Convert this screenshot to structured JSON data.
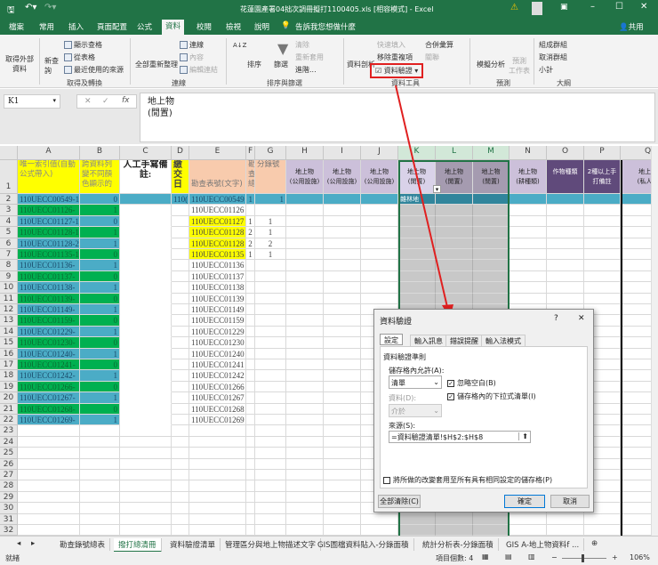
{
  "titlebar": {
    "title": "花蓮園產署04拙次調冊擬打1100405.xls [相容模式] - Excel",
    "share": "共用"
  },
  "ribbon_tabs": [
    "檔案",
    "常用",
    "插入",
    "頁面配置",
    "公式",
    "資料",
    "校閱",
    "檢視",
    "說明"
  ],
  "tell_me": "告訴我您想做什麼",
  "ribbon": {
    "get_external": "取得外部\n資料",
    "new_query": "新查\n詢",
    "show_queries": "顯示查格",
    "from_table": "從表格",
    "recent_sources": "最近使用的來源",
    "group_get": "取得及轉換",
    "refresh_all": "全部重新整理",
    "connections": "連線",
    "properties": "內容",
    "edit_links": "編輯連結",
    "group_conn": "連線",
    "sort": "排序",
    "filter": "篩選",
    "clear": "清除",
    "reapply": "重新套用",
    "advanced": "進階...",
    "group_sort": "排序與篩選",
    "text_to_columns": "資料剖析",
    "flash_fill": "快速填入",
    "remove_dup": "移除重複項",
    "data_validation": "資料驗證",
    "consolidate": "合併彙算",
    "relationships": "關聯",
    "group_tools": "資料工具",
    "what_if": "模擬分析",
    "forecast_sheet": "預測\n工作表",
    "group_forecast": "預測",
    "group": "組成群組",
    "ungroup": "取消群組",
    "subtotal": "小計",
    "group_outline": "大綱"
  },
  "formula_bar": {
    "name_box": "K1",
    "content_line1": "地上物",
    "content_line2": "(閒置)"
  },
  "columns": [
    "A",
    "B",
    "C",
    "D",
    "E",
    "F",
    "G",
    "H",
    "I",
    "J",
    "K",
    "L",
    "M",
    "N",
    "O",
    "P",
    "Q"
  ],
  "header_row": {
    "A": "唯一索引值(自動公式帶入)",
    "B": "跨資料列變不同顏色顯示的",
    "C": "人工手寫備註:",
    "D": "繳交日",
    "E": "勘查表號(文字)",
    "F": "勘查總",
    "G": "分錄號",
    "H": "地上物\n(公用設施)",
    "I": "地上物\n(公用設施)",
    "J": "地上物\n(公用設施)",
    "K": "地上物\n(閒置)",
    "L": "地上物\n(閒置)",
    "M": "地上物\n(閒置)",
    "N": "地上物\n(耕種類)",
    "O": "作物種類",
    "P": "2種以上手打備註",
    "Q": "地上物\n(私人佔"
  },
  "row2": {
    "A": "110UECC00549-1",
    "B": "0",
    "D": "110(",
    "E": "110UECC00549",
    "F": "1",
    "G": "1",
    "K": "雜林地"
  },
  "rows": [
    {
      "A": "110UECC01126-",
      "B": "1",
      "E": "110UECC01126",
      "F": "",
      "G": "",
      "hl": false
    },
    {
      "A": "110UECC01127-1",
      "B": "0",
      "E": "110UECC01127",
      "F": "1",
      "G": "1",
      "hl": true
    },
    {
      "A": "110UECC01128-1",
      "B": "1",
      "E": "110UECC01128",
      "F": "2",
      "G": "1",
      "hl": true
    },
    {
      "A": "110UECC01128-2",
      "B": "1",
      "E": "110UECC01128",
      "F": "2",
      "G": "2",
      "hl": true
    },
    {
      "A": "110UECC01135-1",
      "B": "0",
      "E": "110UECC01135",
      "F": "1",
      "G": "1",
      "hl": true
    },
    {
      "A": "110UECC01136-",
      "B": "1",
      "E": "110UECC01136",
      "F": "",
      "G": "",
      "hl": false
    },
    {
      "A": "110UECC01137-",
      "B": "0",
      "E": "110UECC01137",
      "F": "",
      "G": "",
      "hl": false
    },
    {
      "A": "110UECC01138-",
      "B": "1",
      "E": "110UECC01138",
      "F": "",
      "G": "",
      "hl": false
    },
    {
      "A": "110UECC01139-",
      "B": "0",
      "E": "110UECC01139",
      "F": "",
      "G": "",
      "hl": false
    },
    {
      "A": "110UECC01149-",
      "B": "1",
      "E": "110UECC01149",
      "F": "",
      "G": "",
      "hl": false
    },
    {
      "A": "110UECC01159-",
      "B": "0",
      "E": "110UECC01159",
      "F": "",
      "G": "",
      "hl": false
    },
    {
      "A": "110UECC01229-",
      "B": "1",
      "E": "110UECC01229",
      "F": "",
      "G": "",
      "hl": false
    },
    {
      "A": "110UECC01230-",
      "B": "0",
      "E": "110UECC01230",
      "F": "",
      "G": "",
      "hl": false
    },
    {
      "A": "110UECC01240-",
      "B": "1",
      "E": "110UECC01240",
      "F": "",
      "G": "",
      "hl": false
    },
    {
      "A": "110UECC01241-",
      "B": "0",
      "E": "110UECC01241",
      "F": "",
      "G": "",
      "hl": false
    },
    {
      "A": "110UECC01242-",
      "B": "1",
      "E": "110UECC01242",
      "F": "",
      "G": "",
      "hl": false
    },
    {
      "A": "110UECC01266-",
      "B": "0",
      "E": "110UECC01266",
      "F": "",
      "G": "",
      "hl": false
    },
    {
      "A": "110UECC01267-",
      "B": "1",
      "E": "110UECC01267",
      "F": "",
      "G": "",
      "hl": false
    },
    {
      "A": "110UECC01268-",
      "B": "0",
      "E": "110UECC01268",
      "F": "",
      "G": "",
      "hl": false
    },
    {
      "A": "110UECC01269-",
      "B": "1",
      "E": "110UECC01269",
      "F": "",
      "G": "",
      "hl": false
    }
  ],
  "row_numbers": [
    "1",
    "2",
    "3",
    "4",
    "5",
    "6",
    "7",
    "8",
    "9",
    "10",
    "11",
    "12",
    "13",
    "14",
    "15",
    "16",
    "17",
    "18",
    "19",
    "20",
    "21",
    "22",
    "23",
    "24",
    "25",
    "26",
    "27",
    "28",
    "29",
    "30",
    "31",
    "32"
  ],
  "colors": {
    "green": "#00b050",
    "teal": "#4bacc6",
    "yellow": "#ffff00",
    "orange": "#f8cbad",
    "lavender": "#ccc0da",
    "purple": "#604a7b",
    "excel": "#217346"
  },
  "dialog": {
    "title": "資料驗證",
    "help": "?",
    "close": "✕",
    "tabs": [
      "設定",
      "輸入訊息",
      "錯誤提醒",
      "輸入法模式"
    ],
    "section": "資料驗證準則",
    "allow_label": "儲存格內允許(A):",
    "allow_value": "清單",
    "ignore_blank": "忽略空白(B)",
    "in_cell_dropdown": "儲存格內的下拉式清單(I)",
    "data_label": "資料(D):",
    "data_value": "介於",
    "source_label": "來源(S):",
    "source_value": "=資料驗證清單!$H$2:$H$8",
    "apply_all": "將所做的改變套用至所有具有相同設定的儲存格(P)",
    "clear_all": "全部清除(C)",
    "ok": "確定",
    "cancel": "取消"
  },
  "sheet_tabs": [
    "勘查錄號總表",
    "撥打總清冊",
    "資料驗證清單",
    "管理區分與地上物描述文字",
    "GIS圖檔資料貼入-分錄面積",
    "統計分析表-分錄面積",
    "GIS A-地上物資料f ..."
  ],
  "status": {
    "ready": "就緒",
    "count": "項目個數: 4",
    "zoom": "106%"
  }
}
